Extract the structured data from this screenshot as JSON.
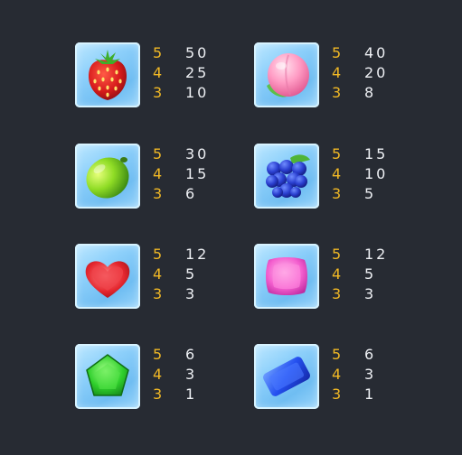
{
  "colors": {
    "background": "#272b33",
    "count": "#f2b925",
    "value": "#eef0f4"
  },
  "symbols": [
    {
      "icon": "strawberry-icon",
      "payouts": [
        {
          "count": "5",
          "value": "50"
        },
        {
          "count": "4",
          "value": "25"
        },
        {
          "count": "3",
          "value": "10"
        }
      ]
    },
    {
      "icon": "peach-icon",
      "payouts": [
        {
          "count": "5",
          "value": "40"
        },
        {
          "count": "4",
          "value": "20"
        },
        {
          "count": "3",
          "value": "8"
        }
      ]
    },
    {
      "icon": "lime-icon",
      "payouts": [
        {
          "count": "5",
          "value": "30"
        },
        {
          "count": "4",
          "value": "15"
        },
        {
          "count": "3",
          "value": "6"
        }
      ]
    },
    {
      "icon": "grapes-icon",
      "payouts": [
        {
          "count": "5",
          "value": "15"
        },
        {
          "count": "4",
          "value": "10"
        },
        {
          "count": "3",
          "value": "5"
        }
      ]
    },
    {
      "icon": "heart-candy-icon",
      "payouts": [
        {
          "count": "5",
          "value": "12"
        },
        {
          "count": "4",
          "value": "5"
        },
        {
          "count": "3",
          "value": "3"
        }
      ]
    },
    {
      "icon": "square-candy-icon",
      "payouts": [
        {
          "count": "5",
          "value": "12"
        },
        {
          "count": "4",
          "value": "5"
        },
        {
          "count": "3",
          "value": "3"
        }
      ]
    },
    {
      "icon": "pentagon-candy-icon",
      "payouts": [
        {
          "count": "5",
          "value": "6"
        },
        {
          "count": "4",
          "value": "3"
        },
        {
          "count": "3",
          "value": "1"
        }
      ]
    },
    {
      "icon": "rectangle-candy-icon",
      "payouts": [
        {
          "count": "5",
          "value": "6"
        },
        {
          "count": "4",
          "value": "3"
        },
        {
          "count": "3",
          "value": "1"
        }
      ]
    }
  ]
}
